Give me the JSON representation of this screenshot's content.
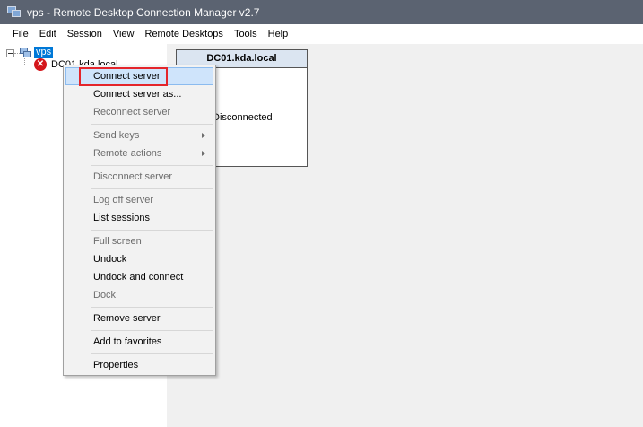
{
  "window": {
    "title": "vps - Remote Desktop Connection Manager v2.7"
  },
  "menubar": {
    "items": [
      "File",
      "Edit",
      "Session",
      "View",
      "Remote Desktops",
      "Tools",
      "Help"
    ]
  },
  "tree": {
    "group_label": "vps",
    "server_label": "DC01.kda.local",
    "server_status_icon": "error-icon"
  },
  "thumbnail": {
    "title": "DC01.kda.local",
    "status": "Disconnected"
  },
  "context_menu": {
    "items": [
      {
        "label": "Connect server",
        "enabled": true,
        "highlighted": true
      },
      {
        "label": "Connect server as...",
        "enabled": true
      },
      {
        "label": "Reconnect server",
        "enabled": false
      },
      {
        "label": "Send keys",
        "enabled": false,
        "submenu": true
      },
      {
        "label": "Remote actions",
        "enabled": false,
        "submenu": true
      },
      {
        "label": "Disconnect server",
        "enabled": false
      },
      {
        "label": "Log off server",
        "enabled": false
      },
      {
        "label": "List sessions",
        "enabled": true
      },
      {
        "label": "Full screen",
        "enabled": false
      },
      {
        "label": "Undock",
        "enabled": true
      },
      {
        "label": "Undock and connect",
        "enabled": true
      },
      {
        "label": "Dock",
        "enabled": false
      },
      {
        "label": "Remove server",
        "enabled": true
      },
      {
        "label": "Add to favorites",
        "enabled": true
      },
      {
        "label": "Properties",
        "enabled": true
      }
    ]
  },
  "colors": {
    "titlebar": "#5b6371",
    "selection": "#0078d7",
    "highlight_outline": "#e4252b"
  }
}
